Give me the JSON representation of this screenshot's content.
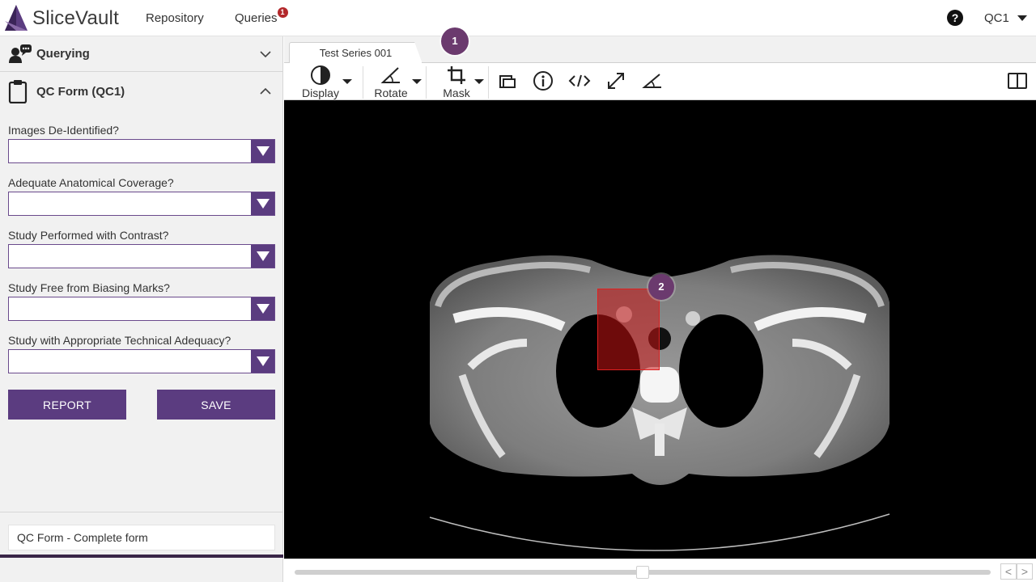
{
  "app": {
    "name": "SliceVault"
  },
  "nav": {
    "repository": "Repository",
    "queries": "Queries",
    "queries_badge": "1"
  },
  "user": {
    "name": "QC1"
  },
  "sidebar": {
    "querying_title": "Querying",
    "form_title": "QC Form (QC1)",
    "fields": [
      {
        "label": "Images De-Identified?",
        "value": ""
      },
      {
        "label": "Adequate Anatomical Coverage?",
        "value": ""
      },
      {
        "label": "Study Performed with Contrast?",
        "value": ""
      },
      {
        "label": "Study Free from Biasing Marks?",
        "value": ""
      },
      {
        "label": "Study with Appropriate Technical Adequacy?",
        "value": ""
      }
    ],
    "report_label": "REPORT",
    "save_label": "SAVE",
    "status_text": "QC Form - Complete form"
  },
  "viewer": {
    "tab_label": "Test Series 001",
    "tools": {
      "display": "Display",
      "rotate": "Rotate",
      "mask": "Mask"
    },
    "markers": {
      "first": "1",
      "second": "2"
    },
    "nav_prev": "<",
    "nav_next": ">"
  },
  "colors": {
    "accent": "#5b3c80",
    "marker": "#6b3a6e",
    "badge": "#b3282b",
    "roi": "#c81414"
  }
}
